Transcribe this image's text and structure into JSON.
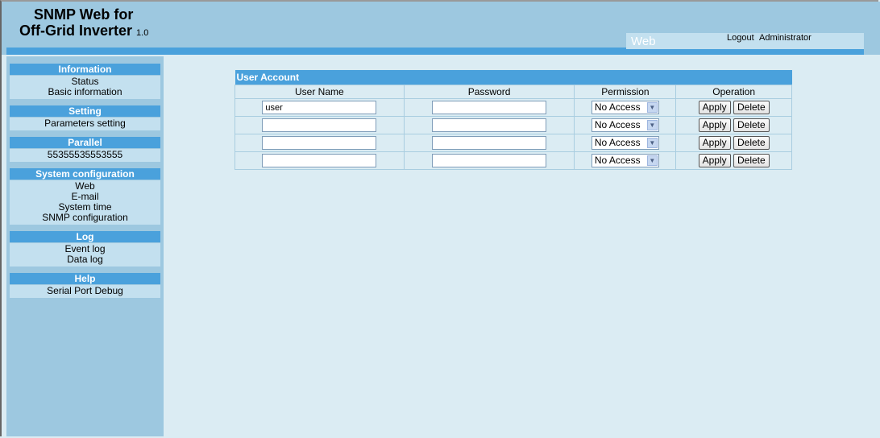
{
  "brand": {
    "line1": "SNMP Web for",
    "line2": "Off-Grid Inverter",
    "version": "1.0"
  },
  "header": {
    "tab": "Web",
    "logout": "Logout",
    "user": "Administrator"
  },
  "sidebar": [
    {
      "title": "Information",
      "items": [
        "Status",
        "Basic information"
      ]
    },
    {
      "title": "Setting",
      "items": [
        "Parameters setting"
      ]
    },
    {
      "title": "Parallel",
      "items": [
        "55355535553555"
      ]
    },
    {
      "title": "System configuration",
      "items": [
        "Web",
        "E-mail",
        "System time",
        "SNMP configuration"
      ]
    },
    {
      "title": "Log",
      "items": [
        "Event log",
        "Data log"
      ]
    },
    {
      "title": "Help",
      "items": [
        "Serial Port Debug"
      ]
    }
  ],
  "account": {
    "title": "User Account",
    "columns": {
      "username": "User Name",
      "password": "Password",
      "permission": "Permission",
      "operation": "Operation"
    },
    "rows": [
      {
        "username": "user",
        "password": "",
        "permission": "No Access"
      },
      {
        "username": "",
        "password": "",
        "permission": "No Access"
      },
      {
        "username": "",
        "password": "",
        "permission": "No Access"
      },
      {
        "username": "",
        "password": "",
        "permission": "No Access"
      }
    ],
    "apply_label": "Apply",
    "delete_label": "Delete"
  }
}
